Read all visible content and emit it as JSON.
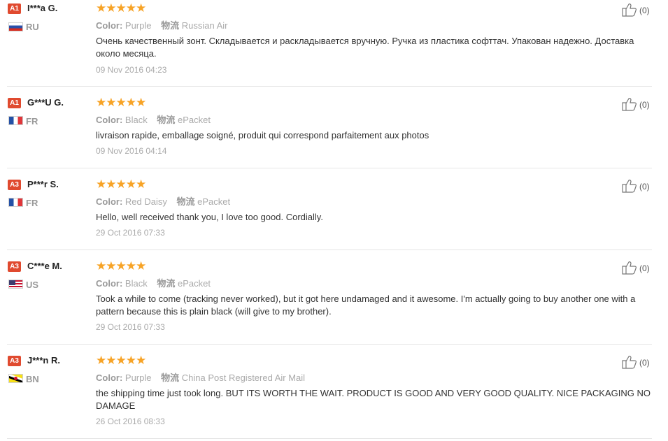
{
  "labels": {
    "color": "Color:",
    "shipping": "物流"
  },
  "reviews": [
    {
      "level": "A1",
      "name": "I***a G.",
      "country": "RU",
      "flag": "ru",
      "stars": "★★★★★",
      "color": "Purple",
      "shipping": "Russian Air",
      "text": "Очень качественный зонт. Складывается и раскладывается вручную. Ручка из пластика софттач. Упакован надежно. Доставка около месяца.",
      "date": "09 Nov 2016 04:23",
      "likes": "(0)"
    },
    {
      "level": "A1",
      "name": "G***U G.",
      "country": "FR",
      "flag": "fr",
      "stars": "★★★★★",
      "color": "Black",
      "shipping": "ePacket",
      "text": "livraison rapide, emballage soigné, produit qui correspond parfaitement aux photos",
      "date": "09 Nov 2016 04:14",
      "likes": "(0)"
    },
    {
      "level": "A3",
      "name": "P***r S.",
      "country": "FR",
      "flag": "fr",
      "stars": "★★★★★",
      "color": "Red Daisy",
      "shipping": "ePacket",
      "text": "Hello, well received thank you, I love too good. Cordially.",
      "date": "29 Oct 2016 07:33",
      "likes": "(0)"
    },
    {
      "level": "A3",
      "name": "C***e M.",
      "country": "US",
      "flag": "us",
      "stars": "★★★★★",
      "color": "Black",
      "shipping": "ePacket",
      "text": "Took a while to come (tracking never worked), but it got here undamaged and it awesome. I'm actually going to buy another one with a pattern because this is plain black (will give to my brother).",
      "date": "29 Oct 2016 07:33",
      "likes": "(0)"
    },
    {
      "level": "A3",
      "name": "J***n R.",
      "country": "BN",
      "flag": "bn",
      "stars": "★★★★★",
      "color": "Purple",
      "shipping": "China Post Registered Air Mail",
      "text": "the shipping time just took long. BUT ITS WORTH THE WAIT. PRODUCT IS GOOD AND VERY GOOD QUALITY. NICE PACKAGING NO DAMAGE",
      "date": "26 Oct 2016 08:33",
      "likes": "(0)"
    }
  ]
}
